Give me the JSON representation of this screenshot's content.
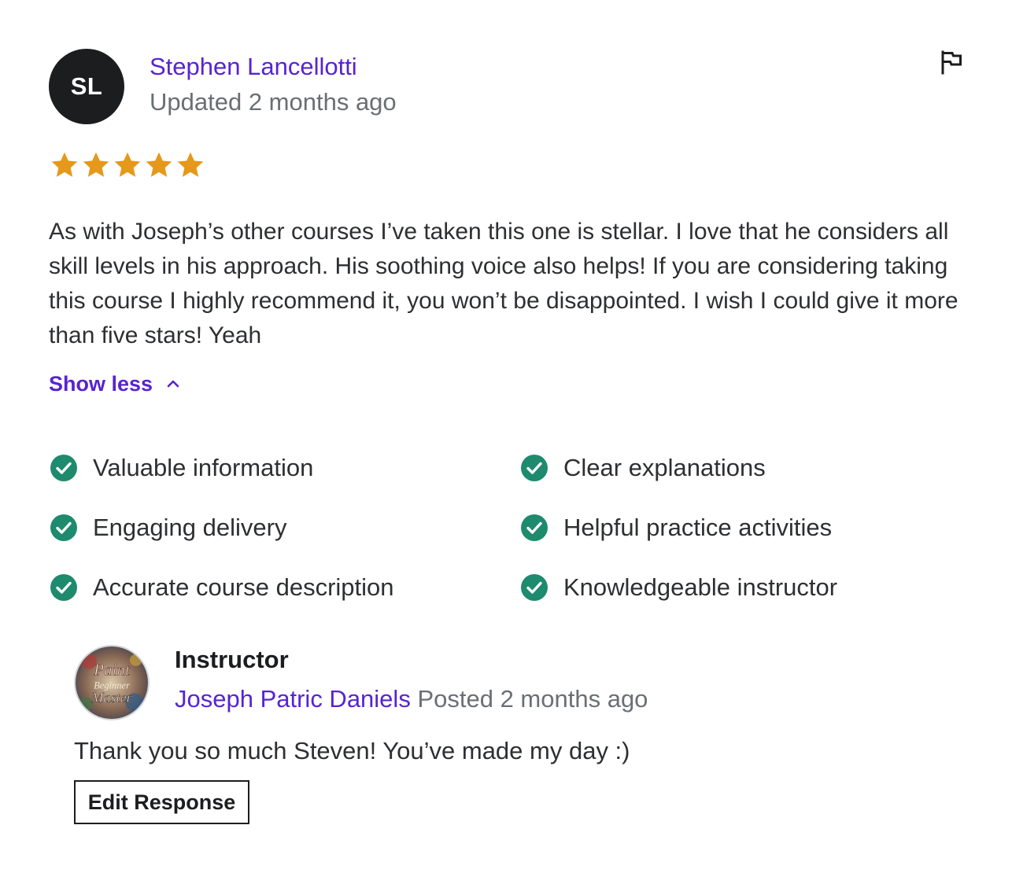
{
  "review": {
    "avatar_initials": "SL",
    "reviewer_name": "Stephen Lancellotti",
    "updated": "Updated 2 months ago",
    "rating": 5,
    "rating_max": 5,
    "star_color": "#e59819",
    "text": "As with Joseph’s other courses I’ve taken this one is stellar. I love that he considers all skill levels in his approach. His soothing voice also helps! If you are considering taking this course I highly recommend it, you won’t be disappointed. I wish I could give it more than five stars! Yeah",
    "show_less_label": "Show less",
    "report_icon": "flag-icon"
  },
  "feedback": {
    "check_color": "#1e8a6e",
    "items": [
      "Valuable information",
      "Clear explanations",
      "Engaging delivery",
      "Helpful practice activities",
      "Accurate course description",
      "Knowledgeable instructor"
    ]
  },
  "instructor_response": {
    "label": "Instructor",
    "name": "Joseph Patric Daniels",
    "posted": "Posted 2 months ago",
    "avatar_text": [
      "Paint",
      "Beginner",
      "Master"
    ],
    "text": "Thank you so much Steven! You’ve made my day :)",
    "edit_button_label": "Edit Response"
  },
  "colors": {
    "link_purple": "#5624d0",
    "muted_gray": "#6a6f73",
    "text_dark": "#2d2f31"
  }
}
